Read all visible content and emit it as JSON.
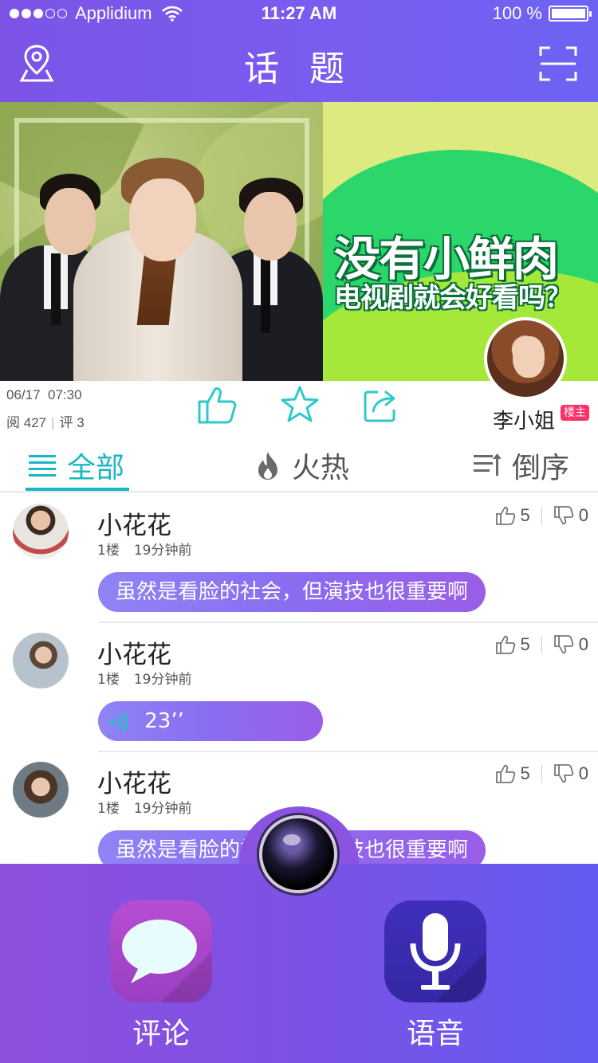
{
  "status_bar": {
    "carrier": "Applidium",
    "time": "11:27 AM",
    "battery": "100 %"
  },
  "header": {
    "title": "话 题",
    "left_icon": "location-pin-icon",
    "right_icon": "scan-frame-icon"
  },
  "banner": {
    "headline": "没有小鲜肉",
    "subheadline": "电视剧就会好看吗？",
    "colors": {
      "left_bg": "#a7bc68",
      "right_bg": "#dcea80",
      "wave": "#2bd66b"
    }
  },
  "post_meta": {
    "date": "06/17",
    "time": "07:30",
    "views_label": "阅",
    "views": "427",
    "comments_label": "评",
    "comments": "3",
    "author": "李小姐",
    "author_badge": "楼主"
  },
  "tabs": [
    {
      "label": "全部",
      "icon": "list-icon",
      "active": true
    },
    {
      "label": "火热",
      "icon": "flame-icon",
      "active": false
    },
    {
      "label": "倒序",
      "icon": "sort-icon",
      "active": false
    }
  ],
  "comments": [
    {
      "name": "小花花",
      "floor": "1楼",
      "time": "19分钟前",
      "likes": "5",
      "dislikes": "0",
      "type": "text",
      "content": "虽然是看脸的社会，但演技也很重要啊"
    },
    {
      "name": "小花花",
      "floor": "1楼",
      "time": "19分钟前",
      "likes": "5",
      "dislikes": "0",
      "type": "voice",
      "content": "23’’"
    },
    {
      "name": "小花花",
      "floor": "1楼",
      "time": "19分钟前",
      "likes": "5",
      "dislikes": "0",
      "type": "text",
      "content": "虽然是看脸的社会，但演技也很重要啊"
    }
  ],
  "bottom_bar": {
    "comment_label": "评论",
    "voice_label": "语音",
    "colors": {
      "accent": "#19b7c4",
      "purple": "#7a52e6"
    }
  }
}
